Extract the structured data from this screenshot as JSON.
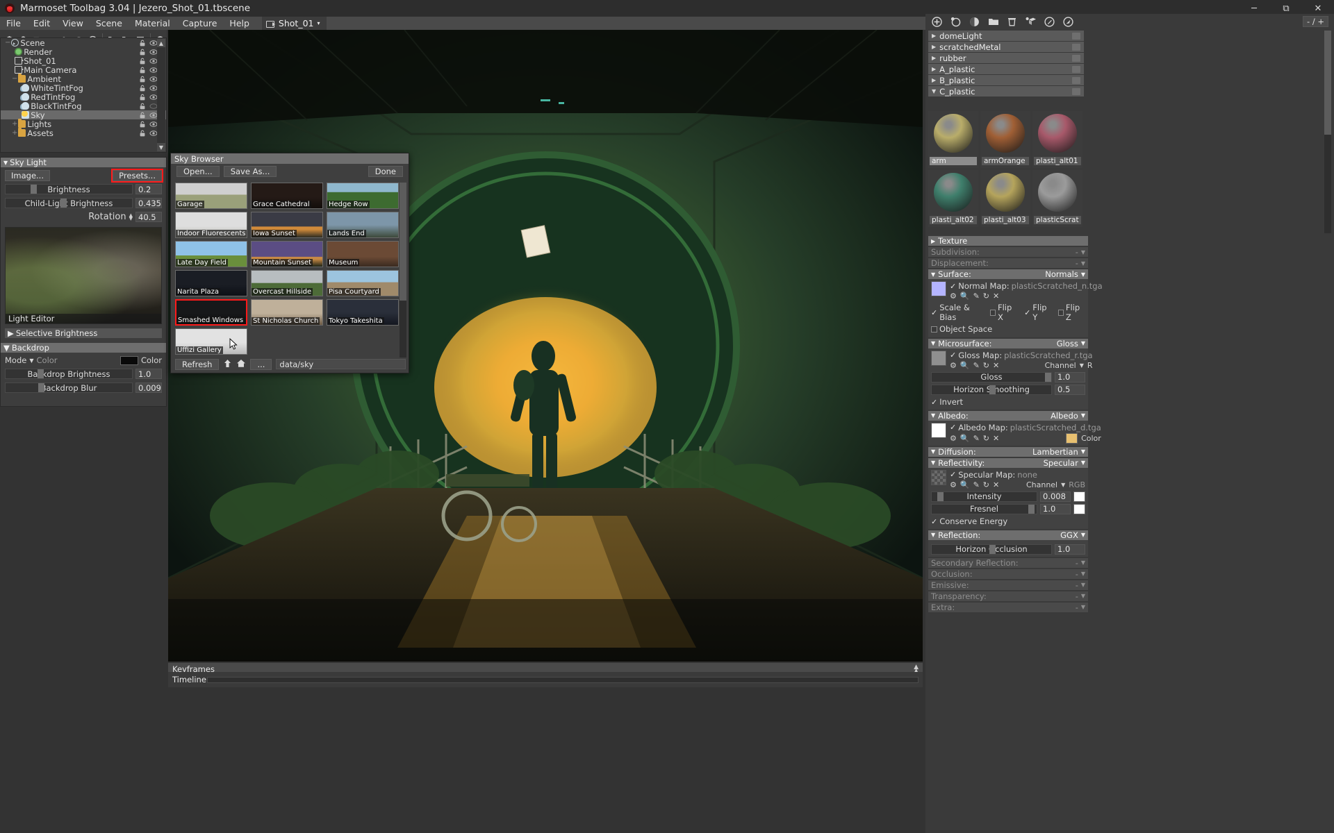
{
  "window": {
    "title": "Marmoset Toolbag 3.04  |  Jezero_Shot_01.tbscene",
    "logo_icon": "marmoset-logo-icon",
    "minimize": "─",
    "maximize": "❐",
    "restore": "⧉",
    "close": "✕"
  },
  "menubar": {
    "items": [
      "File",
      "Edit",
      "View",
      "Scene",
      "Material",
      "Capture",
      "Help"
    ],
    "shot_tab": {
      "label": "Shot_01",
      "icon": "camera-icon",
      "caret": "▾"
    }
  },
  "left_toolbar": {
    "icons": [
      "cube-icon",
      "light-bulb-icon",
      "camera-icon",
      "fog-icon",
      "sky-icon",
      "material-icon",
      "render-icon",
      "folder-icon",
      "duplicate-icon",
      "trash-icon",
      "gear-icon",
      "light-editor-icon"
    ]
  },
  "scene_tree": {
    "items": [
      {
        "label": "Scene",
        "icon": "scene-icon",
        "depth": 0,
        "expander": "−",
        "selected": false,
        "lock": true,
        "eye": true
      },
      {
        "label": "Render",
        "icon": "gear-icon",
        "depth": 1,
        "expander": "",
        "selected": false,
        "lock": true,
        "eye": true
      },
      {
        "label": "Shot_01",
        "icon": "camera-icon",
        "depth": 1,
        "expander": "",
        "selected": false,
        "lock": true,
        "eye": true
      },
      {
        "label": "Main Camera",
        "icon": "camera-icon",
        "depth": 1,
        "expander": "",
        "selected": false,
        "lock": true,
        "eye": true
      },
      {
        "label": "Ambient",
        "icon": "folder-icon",
        "depth": 1,
        "expander": "−",
        "selected": false,
        "lock": true,
        "eye": true
      },
      {
        "label": "WhiteTintFog",
        "icon": "fog-icon",
        "depth": 2,
        "expander": "",
        "selected": false,
        "lock": true,
        "eye": true
      },
      {
        "label": "RedTintFog",
        "icon": "fog-icon",
        "depth": 2,
        "expander": "",
        "selected": false,
        "lock": true,
        "eye": true
      },
      {
        "label": "BlackTintFog",
        "icon": "fog-icon",
        "depth": 2,
        "expander": "",
        "selected": false,
        "lock": true,
        "eye": false
      },
      {
        "label": "Sky",
        "icon": "sky-icon",
        "depth": 2,
        "expander": "",
        "selected": true,
        "lock": true,
        "eye": true
      },
      {
        "label": "Lights",
        "icon": "folder-icon",
        "depth": 1,
        "expander": "+",
        "selected": false,
        "lock": true,
        "eye": true
      },
      {
        "label": "Assets",
        "icon": "folder-icon",
        "depth": 1,
        "expander": "+",
        "selected": false,
        "lock": true,
        "eye": true
      }
    ]
  },
  "sky_light": {
    "header": "Sky Light",
    "caret": "▼",
    "image_button": "Image...",
    "presets_button": "Presets...",
    "brightness": {
      "label": "Brightness",
      "value": "0.2",
      "fill": 0.2
    },
    "child_light_brightness": {
      "label": "Child-Light Brightness",
      "value": "0.435",
      "fill": 0.435
    },
    "rotation": {
      "label": "Rotation",
      "value": "40.5",
      "spinner": "▴▾"
    },
    "preview_caption": "Light Editor",
    "selective_brightness": {
      "label": "Selective Brightness",
      "caret": "▶"
    }
  },
  "backdrop": {
    "header": "Backdrop",
    "caret": "▼",
    "mode_label": "Mode",
    "mode_caret": "▼",
    "mode_value": "Color",
    "color_label": "Color",
    "color_value": "#0a0a0a",
    "brightness": {
      "label": "Backdrop Brightness",
      "value": "1.0",
      "fill": 0.25
    },
    "blur": {
      "label": "Backdrop Blur",
      "value": "0.009",
      "fill": 0.26
    }
  },
  "sky_browser": {
    "title": "Sky Browser",
    "open_button": "Open...",
    "save_as_button": "Save As...",
    "done_button": "Done",
    "refresh_button": "Refresh",
    "up_icon": "arrow-up-icon",
    "home_icon": "home-icon",
    "ellipsis_button": "...",
    "path": "data/sky",
    "cursor_icon": "mouse-cursor-icon",
    "items": [
      {
        "label": "Garage",
        "selected": false,
        "thumb": "garage"
      },
      {
        "label": "Grace Cathedral",
        "selected": false,
        "thumb": "grace"
      },
      {
        "label": "Hedge Row",
        "selected": false,
        "thumb": "hedge"
      },
      {
        "label": "Indoor Fluorescents",
        "selected": false,
        "thumb": "indoor"
      },
      {
        "label": "Iowa Sunset",
        "selected": false,
        "thumb": "iowa"
      },
      {
        "label": "Lands End",
        "selected": false,
        "thumb": "lands"
      },
      {
        "label": "Late Day Field",
        "selected": false,
        "thumb": "lateday"
      },
      {
        "label": "Mountain Sunset",
        "selected": false,
        "thumb": "mountain"
      },
      {
        "label": "Museum",
        "selected": false,
        "thumb": "museum"
      },
      {
        "label": "Narita Plaza",
        "selected": false,
        "thumb": "narita"
      },
      {
        "label": "Overcast Hillside",
        "selected": false,
        "thumb": "overcast"
      },
      {
        "label": "Pisa Courtyard",
        "selected": false,
        "thumb": "pisa"
      },
      {
        "label": "Smashed Windows",
        "selected": true,
        "thumb": "smashed"
      },
      {
        "label": "St Nicholas Church",
        "selected": false,
        "thumb": "stnicholas"
      },
      {
        "label": "Tokyo Takeshita",
        "selected": false,
        "thumb": "tokyo"
      },
      {
        "label": "Uffizi Gallery",
        "selected": false,
        "thumb": "uffizi"
      }
    ]
  },
  "right_panel": {
    "toolbar_icons": [
      "add-icon",
      "add-material-icon",
      "checker-icon",
      "folder-icon",
      "trash-icon",
      "assign-icon",
      "paint-icon",
      "pick-icon"
    ],
    "count_label": "- / +",
    "materials": [
      {
        "label": "domeLight",
        "expanded": false,
        "caret": "▶"
      },
      {
        "label": "scratchedMetal",
        "expanded": false,
        "caret": "▶"
      },
      {
        "label": "rubber",
        "expanded": false,
        "caret": "▶"
      },
      {
        "label": "A_plastic",
        "expanded": false,
        "caret": "▶"
      },
      {
        "label": "B_plastic",
        "expanded": false,
        "caret": "▶"
      },
      {
        "label": "C_plastic",
        "expanded": true,
        "caret": "▼"
      }
    ],
    "swatches": [
      {
        "label": "arm",
        "color": "#b9ad6a",
        "selected": true
      },
      {
        "label": "armOrange",
        "color": "#a05f35",
        "selected": false
      },
      {
        "label": "plasti_alt01",
        "color": "#a8596a",
        "selected": false
      },
      {
        "label": "plasti_alt02",
        "color": "#3f7f6c",
        "selected": false
      },
      {
        "label": "plasti_alt03",
        "color": "#b5a45c",
        "selected": false
      },
      {
        "label": "plasticScrat",
        "color": "#9b9b9b",
        "selected": false
      }
    ],
    "properties": {
      "texture": {
        "label": "Texture",
        "caret": "▶",
        "value": "",
        "disabled": false
      },
      "subdivision": {
        "label": "Subdivision:",
        "caret": "▼",
        "value": "-",
        "disabled": true
      },
      "displacement": {
        "label": "Displacement:",
        "caret": "▼",
        "value": "-",
        "disabled": true
      },
      "surface": {
        "label": "Surface:",
        "caret": "▼",
        "value": "Normals",
        "map_label": "Normal Map:",
        "map_file": "plasticScratched_n.tga",
        "map_checked": true,
        "thumb_color": "#b4b4ff",
        "icons": [
          "gear-icon",
          "search-icon",
          "pencil-icon",
          "reload-icon",
          "close-icon"
        ],
        "options": [
          {
            "label": "Scale & Bias",
            "checked": true
          },
          {
            "label": "Flip X",
            "checked": false
          },
          {
            "label": "Flip Y",
            "checked": true
          },
          {
            "label": "Flip Z",
            "checked": false
          },
          {
            "label": "Object Space",
            "checked": false
          }
        ]
      },
      "microsurface": {
        "label": "Microsurface:",
        "caret": "▼",
        "value": "Gloss",
        "map_label": "Gloss Map:",
        "map_file": "plasticScratched_r.tga",
        "map_checked": true,
        "thumb_color": "#8f8f8f",
        "channel_label": "Channel",
        "channel_caret": "▼",
        "channel_value": "R",
        "gloss": {
          "label": "Gloss",
          "value": "1.0",
          "fill": 0.95
        },
        "horizon": {
          "label": "Horizon Smoothing",
          "value": "0.5",
          "fill": 0.5
        },
        "invert": {
          "label": "Invert",
          "checked": true
        }
      },
      "albedo": {
        "label": "Albedo:",
        "caret": "▼",
        "value": "Albedo",
        "map_label": "Albedo Map:",
        "map_file": "plasticScratched_d.tga",
        "map_checked": true,
        "thumb_color": "#ffffff",
        "color_label": "Color",
        "color_value": "#e8c070"
      },
      "diffusion": {
        "label": "Diffusion:",
        "caret": "▼",
        "value": "Lambertian"
      },
      "reflectivity": {
        "label": "Reflectivity:",
        "caret": "▼",
        "value": "Specular",
        "map_label": "Specular Map:",
        "map_file": "none",
        "map_checked": true,
        "channel_label": "Channel",
        "channel_caret": "▼",
        "channel_value": "RGB",
        "intensity": {
          "label": "Intensity",
          "value": "0.008",
          "fill": 0.06,
          "color": "#ffffff"
        },
        "fresnel": {
          "label": "Fresnel",
          "value": "1.0",
          "fill": 0.93,
          "color": "#ffffff"
        },
        "conserve": {
          "label": "Conserve Energy",
          "checked": true
        }
      },
      "reflection": {
        "label": "Reflection:",
        "caret": "▼",
        "value": "GGX",
        "horizon_occlusion": {
          "label": "Horizon Occlusion",
          "value": "1.0",
          "fill": 0.5
        }
      },
      "secondary_reflection": {
        "label": "Secondary Reflection:",
        "caret": "▼",
        "value": "-",
        "disabled": true
      },
      "occlusion": {
        "label": "Occlusion:",
        "caret": "▼",
        "value": "-",
        "disabled": true
      },
      "emissive": {
        "label": "Emissive:",
        "caret": "▼",
        "value": "-",
        "disabled": true
      },
      "transparency": {
        "label": "Transparency:",
        "caret": "▼",
        "value": "-",
        "disabled": true
      },
      "extra": {
        "label": "Extra:",
        "caret": "▼",
        "value": "-",
        "disabled": true
      }
    }
  },
  "bottom": {
    "keyframes_label": "Keyframes",
    "timeline_label": "Timeline"
  }
}
